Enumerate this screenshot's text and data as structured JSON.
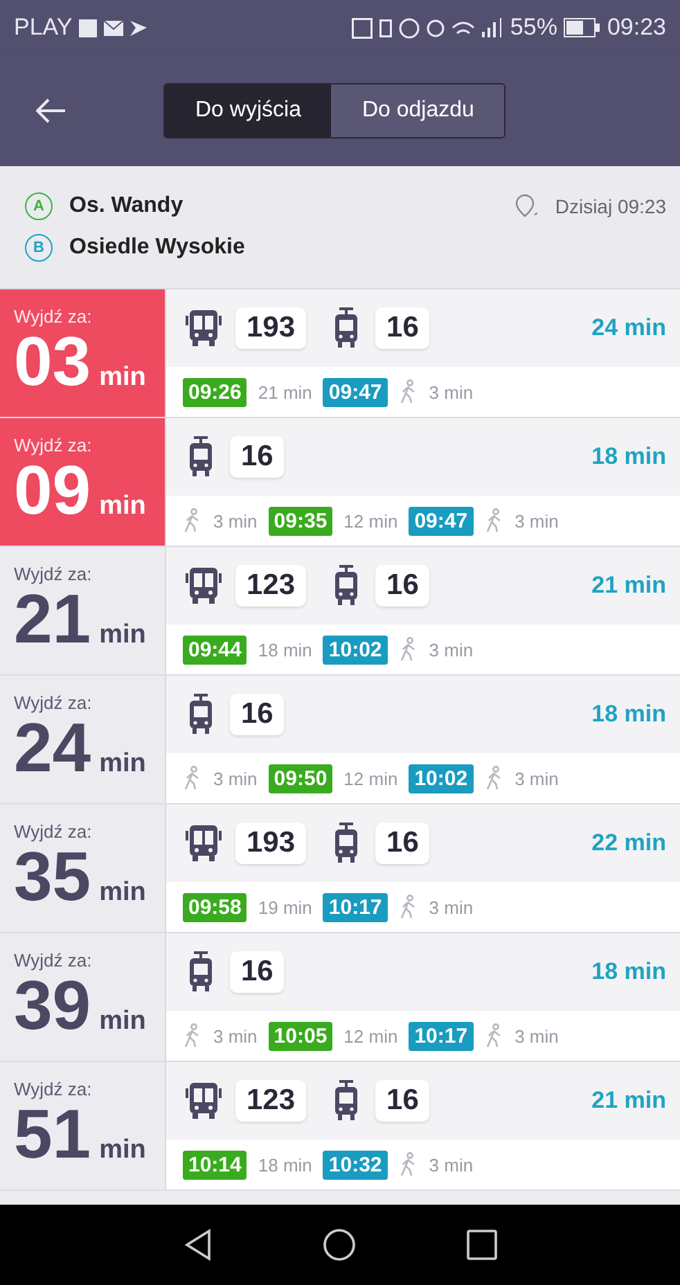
{
  "status_bar": {
    "carrier": "PLAY",
    "battery": "55%",
    "time": "09:23"
  },
  "tabs": [
    {
      "label": "Do wyjścia",
      "selected": true
    },
    {
      "label": "Do odjazdu",
      "selected": false
    }
  ],
  "route": {
    "from": {
      "badge": "A",
      "name": "Os. Wandy",
      "color": "#3cb43c"
    },
    "to": {
      "badge": "B",
      "name": "Osiedle Wysokie",
      "color": "#1fa3c2"
    },
    "when": "Dzisiaj 09:23"
  },
  "trips": [
    {
      "label": "Wyjdź za:",
      "minutes": "03",
      "unit": "min",
      "urgent": true,
      "duration": "24 min",
      "lines": [
        {
          "kind": "bus",
          "number": "193"
        },
        {
          "kind": "tram",
          "number": "16"
        }
      ],
      "timeline": [
        {
          "kind": "depart",
          "text": "09:26"
        },
        {
          "kind": "ride",
          "text": "21 min"
        },
        {
          "kind": "arrive",
          "text": "09:47"
        },
        {
          "kind": "walk",
          "text": "3 min"
        }
      ]
    },
    {
      "label": "Wyjdź za:",
      "minutes": "09",
      "unit": "min",
      "urgent": true,
      "duration": "18 min",
      "lines": [
        {
          "kind": "tram",
          "number": "16"
        }
      ],
      "timeline": [
        {
          "kind": "walk",
          "text": "3 min"
        },
        {
          "kind": "depart",
          "text": "09:35"
        },
        {
          "kind": "ride",
          "text": "12 min"
        },
        {
          "kind": "arrive",
          "text": "09:47"
        },
        {
          "kind": "walk",
          "text": "3 min"
        }
      ]
    },
    {
      "label": "Wyjdź za:",
      "minutes": "21",
      "unit": "min",
      "urgent": false,
      "duration": "21 min",
      "lines": [
        {
          "kind": "bus",
          "number": "123"
        },
        {
          "kind": "tram",
          "number": "16"
        }
      ],
      "timeline": [
        {
          "kind": "depart",
          "text": "09:44"
        },
        {
          "kind": "ride",
          "text": "18 min"
        },
        {
          "kind": "arrive",
          "text": "10:02"
        },
        {
          "kind": "walk",
          "text": "3 min"
        }
      ]
    },
    {
      "label": "Wyjdź za:",
      "minutes": "24",
      "unit": "min",
      "urgent": false,
      "duration": "18 min",
      "lines": [
        {
          "kind": "tram",
          "number": "16"
        }
      ],
      "timeline": [
        {
          "kind": "walk",
          "text": "3 min"
        },
        {
          "kind": "depart",
          "text": "09:50"
        },
        {
          "kind": "ride",
          "text": "12 min"
        },
        {
          "kind": "arrive",
          "text": "10:02"
        },
        {
          "kind": "walk",
          "text": "3 min"
        }
      ]
    },
    {
      "label": "Wyjdź za:",
      "minutes": "35",
      "unit": "min",
      "urgent": false,
      "duration": "22 min",
      "lines": [
        {
          "kind": "bus",
          "number": "193"
        },
        {
          "kind": "tram",
          "number": "16"
        }
      ],
      "timeline": [
        {
          "kind": "depart",
          "text": "09:58"
        },
        {
          "kind": "ride",
          "text": "19 min"
        },
        {
          "kind": "arrive",
          "text": "10:17"
        },
        {
          "kind": "walk",
          "text": "3 min"
        }
      ]
    },
    {
      "label": "Wyjdź za:",
      "minutes": "39",
      "unit": "min",
      "urgent": false,
      "duration": "18 min",
      "lines": [
        {
          "kind": "tram",
          "number": "16"
        }
      ],
      "timeline": [
        {
          "kind": "walk",
          "text": "3 min"
        },
        {
          "kind": "depart",
          "text": "10:05"
        },
        {
          "kind": "ride",
          "text": "12 min"
        },
        {
          "kind": "arrive",
          "text": "10:17"
        },
        {
          "kind": "walk",
          "text": "3 min"
        }
      ]
    },
    {
      "label": "Wyjdź za:",
      "minutes": "51",
      "unit": "min",
      "urgent": false,
      "duration": "21 min",
      "lines": [
        {
          "kind": "bus",
          "number": "123"
        },
        {
          "kind": "tram",
          "number": "16"
        }
      ],
      "timeline": [
        {
          "kind": "depart",
          "text": "10:14"
        },
        {
          "kind": "ride",
          "text": "18 min"
        },
        {
          "kind": "arrive",
          "text": "10:32"
        },
        {
          "kind": "walk",
          "text": "3 min"
        }
      ]
    }
  ]
}
